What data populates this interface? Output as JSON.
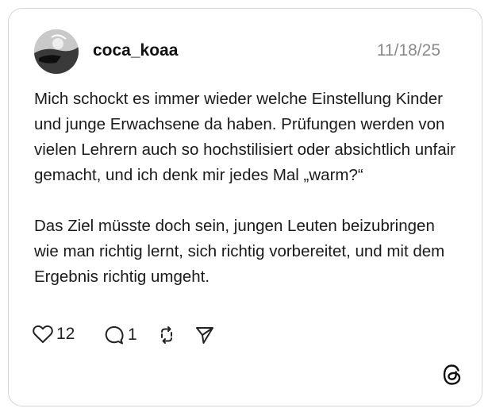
{
  "post": {
    "username": "coca_koaa",
    "date": "11/18/25",
    "text": "Mich schockt es immer wieder welche Einstellung Kinder und junge Erwachsene da haben. Prüfungen werden von vielen Lehrern auch so hochstilisiert oder absichtlich unfair gemacht, und ich denk mir jedes Mal „warm?“\n\nDas Ziel müsste doch sein, jungen Leuten beizubringen wie man richtig lernt, sich richtig vorbereitet, und mit dem Ergebnis richtig umgeht."
  },
  "actions": {
    "like_count": "12",
    "reply_count": "1",
    "like_icon": "heart-icon",
    "reply_icon": "speech-bubble-icon",
    "repost_icon": "repost-icon",
    "share_icon": "send-icon"
  },
  "branding": {
    "logo_icon": "threads-logo-icon"
  }
}
